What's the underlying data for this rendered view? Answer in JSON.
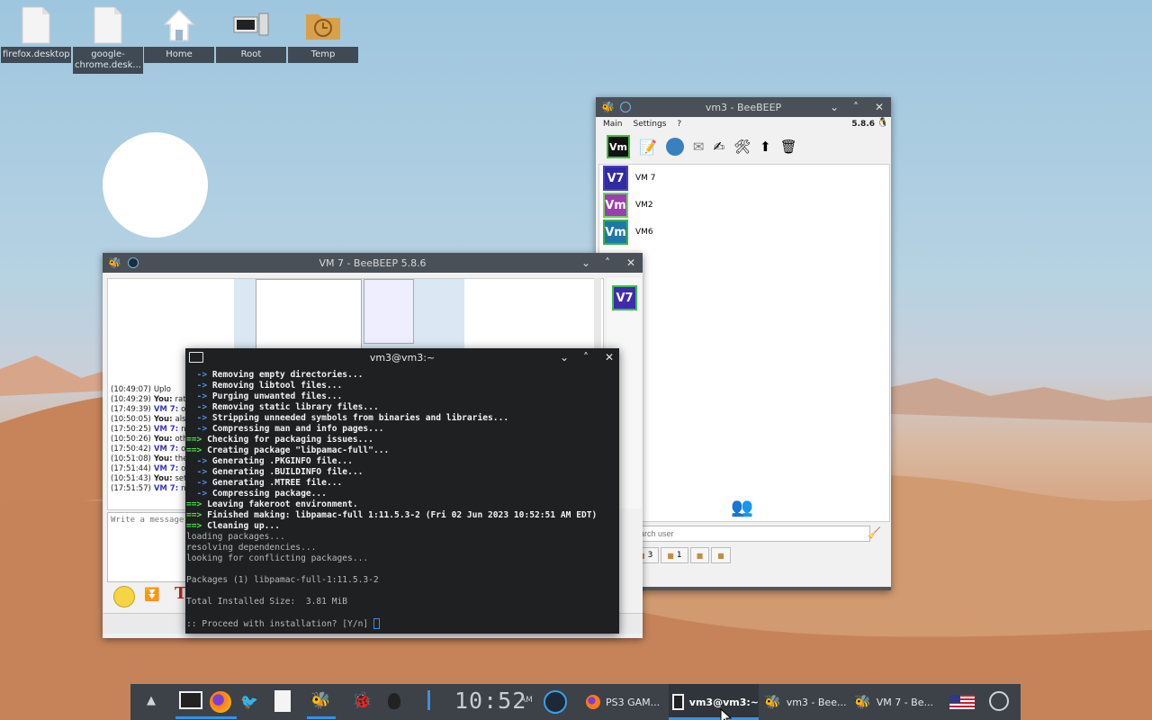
{
  "desktop_icons": [
    {
      "label": "firefox.desktop",
      "icon": "file-icon"
    },
    {
      "label": "google-chrome.desk...",
      "icon": "file-icon"
    },
    {
      "label": "Home",
      "icon": "home-icon"
    },
    {
      "label": "Root",
      "icon": "computer-icon"
    },
    {
      "label": "Temp",
      "icon": "folder-clock-icon"
    }
  ],
  "beebeep_main": {
    "title": "vm3 - BeeBEEP",
    "menu": [
      "Main",
      "Settings",
      "?"
    ],
    "version": "5.8.6",
    "status_badge": "Vm",
    "users": [
      {
        "avatar": "V7",
        "name": "VM 7",
        "color": "#2f2ba0",
        "border": "#4a3cc9"
      },
      {
        "avatar": "Vm",
        "name": "VM2",
        "color": "#9b3eb0",
        "border": "#6fcf5a"
      },
      {
        "avatar": "Vm",
        "name": "VM6",
        "color": "#1d78a8",
        "border": "#39b24a"
      }
    ],
    "search_placeholder": "Search user",
    "tabs": [
      {
        "icon": "users-icon",
        "count": "3"
      },
      {
        "icon": "chat-icon",
        "count": "1"
      },
      {
        "icon": "group-icon",
        "count": ""
      },
      {
        "icon": "share-icon",
        "count": ""
      }
    ]
  },
  "beebeep_chat": {
    "title": "VM 7 - BeeBEEP 5.8.6",
    "side_avatar": "V7",
    "messages": [
      {
        "time": "(10:49:07)",
        "who": "",
        "text": "Uplo"
      },
      {
        "time": "(10:49:29)",
        "who": "You:",
        "text": "rate"
      },
      {
        "time": "(17:49:39)",
        "who": "VM 7:",
        "text": "oh"
      },
      {
        "time": "(10:50:05)",
        "who": "You:",
        "text": "also"
      },
      {
        "time": "(17:50:25)",
        "who": "VM 7:",
        "text": "no"
      },
      {
        "time": "(10:50:26)",
        "who": "You:",
        "text": "othe"
      },
      {
        "time": "(17:50:42)",
        "who": "VM 7:",
        "text": "oh"
      },
      {
        "time": "(10:51:08)",
        "who": "You:",
        "text": "there"
      },
      {
        "time": "(17:51:44)",
        "who": "VM 7:",
        "text": "oh"
      },
      {
        "time": "(10:51:43)",
        "who": "You:",
        "text": "set t"
      },
      {
        "time": "(17:51:57)",
        "who": "VM 7:",
        "text": "nad"
      }
    ],
    "input_placeholder": "Write a message to V"
  },
  "terminal": {
    "title": "vm3@vm3:~",
    "lines": [
      {
        "p": "  -> ",
        "t": "Removing empty directories...",
        "k": "arrow"
      },
      {
        "p": "  -> ",
        "t": "Removing libtool files...",
        "k": "arrow"
      },
      {
        "p": "  -> ",
        "t": "Purging unwanted files...",
        "k": "arrow"
      },
      {
        "p": "  -> ",
        "t": "Removing static library files...",
        "k": "arrow"
      },
      {
        "p": "  -> ",
        "t": "Stripping unneeded symbols from binaries and libraries...",
        "k": "arrow"
      },
      {
        "p": "  -> ",
        "t": "Compressing man and info pages...",
        "k": "arrow"
      },
      {
        "p": "==> ",
        "t": "Checking for packaging issues...",
        "k": "ok"
      },
      {
        "p": "==> ",
        "t": "Creating package \"libpamac-full\"...",
        "k": "ok"
      },
      {
        "p": "  -> ",
        "t": "Generating .PKGINFO file...",
        "k": "arrow"
      },
      {
        "p": "  -> ",
        "t": "Generating .BUILDINFO file...",
        "k": "arrow"
      },
      {
        "p": "  -> ",
        "t": "Generating .MTREE file...",
        "k": "arrow"
      },
      {
        "p": "  -> ",
        "t": "Compressing package...",
        "k": "arrow"
      },
      {
        "p": "==> ",
        "t": "Leaving fakeroot environment.",
        "k": "ok"
      },
      {
        "p": "==> ",
        "t": "Finished making: libpamac-full 1:11.5.3-2 (Fri 02 Jun 2023 10:52:51 AM EDT)",
        "k": "ok"
      },
      {
        "p": "==> ",
        "t": "Cleaning up...",
        "k": "ok"
      },
      {
        "p": "",
        "t": "loading packages...",
        "k": "plain"
      },
      {
        "p": "",
        "t": "resolving dependencies...",
        "k": "plain"
      },
      {
        "p": "",
        "t": "looking for conflicting packages...",
        "k": "plain"
      },
      {
        "p": "",
        "t": "",
        "k": "plain"
      },
      {
        "p": "",
        "t": "Packages (1) libpamac-full-1:11.5.3-2",
        "k": "plain"
      },
      {
        "p": "",
        "t": "",
        "k": "plain"
      },
      {
        "p": "",
        "t": "Total Installed Size:  3.81 MiB",
        "k": "plain"
      },
      {
        "p": "",
        "t": "",
        "k": "plain"
      },
      {
        "p": "",
        "t": ":: Proceed with installation? [Y/n] ",
        "k": "prompt"
      }
    ]
  },
  "taskbar": {
    "clock": "10:52",
    "ampm": "AM",
    "tasks": [
      {
        "label": "PS3 GAM...",
        "icon": "firefox-icon",
        "active": false
      },
      {
        "label": "vm3@vm3:~",
        "icon": "terminal-icon",
        "active": true
      },
      {
        "label": "vm3 - Bee...",
        "icon": "beebeep-icon",
        "active": false
      },
      {
        "label": "VM 7 - Be...",
        "icon": "beebeep-icon",
        "active": false
      }
    ]
  }
}
